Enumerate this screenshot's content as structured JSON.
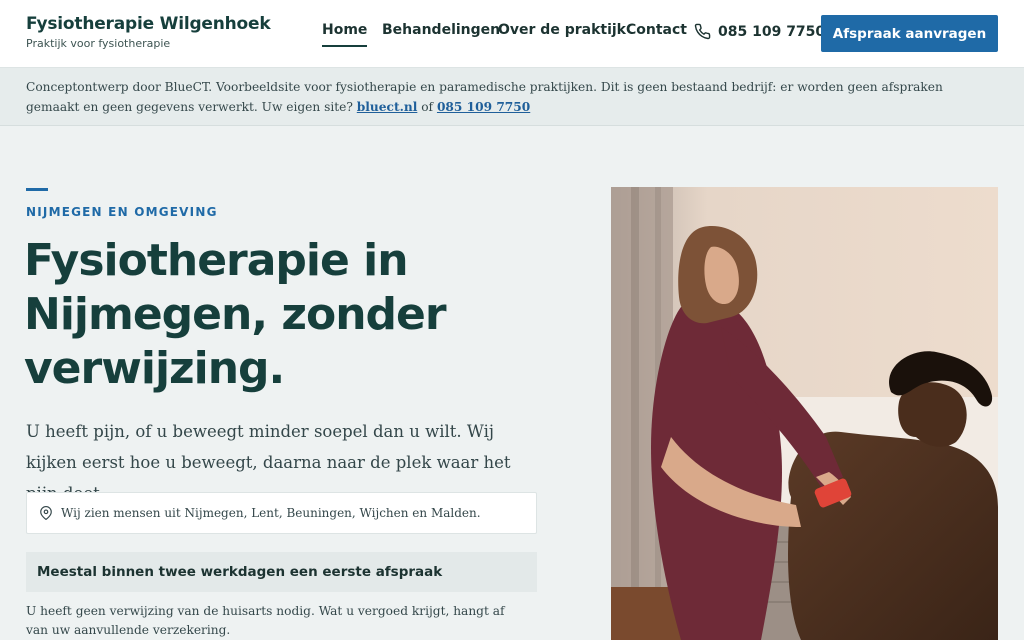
{
  "header": {
    "brand_name": "Fysiotherapie Wilgenhoek",
    "brand_tagline": "Praktijk voor fysiotherapie",
    "nav": [
      {
        "label": "Home",
        "active": true
      },
      {
        "label": "Behandelingen",
        "active": false
      },
      {
        "label": "Over de praktijk",
        "active": false
      },
      {
        "label": "Contact",
        "active": false
      }
    ],
    "phone": "085 109 7750",
    "cta_label": "Afspraak aanvragen"
  },
  "notice": {
    "text": "Conceptontwerp door BlueCT. Voorbeeldsite voor fysiotherapie en paramedische praktijken. Dit is geen bestaand bedrijf: er worden geen afspraken gemaakt en geen gegevens verwerkt. Uw eigen site?",
    "link1": "bluect.nl",
    "between": "of",
    "link2": "085 109 7750"
  },
  "hero": {
    "eyebrow": "NIJMEGEN EN OMGEVING",
    "title": "Fysiotherapie in Nijmegen, zonder verwijzing.",
    "lead": "U heeft pijn, of u beweegt minder soepel dan u wilt. Wij kijken eerst hoe u beweegt, daarna naar de plek waar het pijn doet.",
    "region": "Wij zien mensen uit Nijmegen, Lent, Beuningen, Wijchen en Malden.",
    "speed": "Meestal binnen twee werkdagen een eerste afspraak",
    "footnote": "U heeft geen verwijzing van de huisarts nodig. Wat u vergoed krijgt, hangt af van uw aanvullende verzekering."
  },
  "colors": {
    "accent": "#1f6aa7",
    "heading": "#163f3c",
    "background": "#eef2f2"
  },
  "icons": {
    "phone": "phone-icon",
    "location": "map-pin-icon"
  }
}
